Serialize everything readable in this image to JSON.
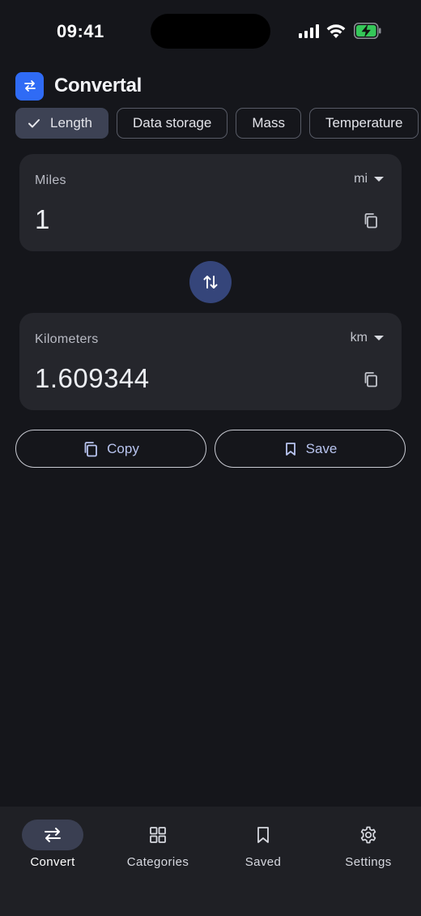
{
  "status_bar": {
    "time": "09:41"
  },
  "app": {
    "title": "Convertal",
    "logo_icon": "swap-arrows-icon"
  },
  "categories": [
    {
      "label": "Length",
      "selected": true
    },
    {
      "label": "Data storage",
      "selected": false
    },
    {
      "label": "Mass",
      "selected": false
    },
    {
      "label": "Temperature",
      "selected": false
    }
  ],
  "from": {
    "unit_name": "Miles",
    "unit_symbol": "mi",
    "value": "1"
  },
  "to": {
    "unit_name": "Kilometers",
    "unit_symbol": "km",
    "value": "1.609344"
  },
  "actions": {
    "copy_label": "Copy",
    "save_label": "Save"
  },
  "nav": [
    {
      "label": "Convert",
      "icon": "swap-arrows-icon",
      "active": true
    },
    {
      "label": "Categories",
      "icon": "grid-icon",
      "active": false
    },
    {
      "label": "Saved",
      "icon": "bookmark-icon",
      "active": false
    },
    {
      "label": "Settings",
      "icon": "gear-icon",
      "active": false
    }
  ],
  "colors": {
    "accent": "#2f6bf5",
    "swap_button": "#35457a",
    "background": "#15161b",
    "card": "#25262c"
  }
}
